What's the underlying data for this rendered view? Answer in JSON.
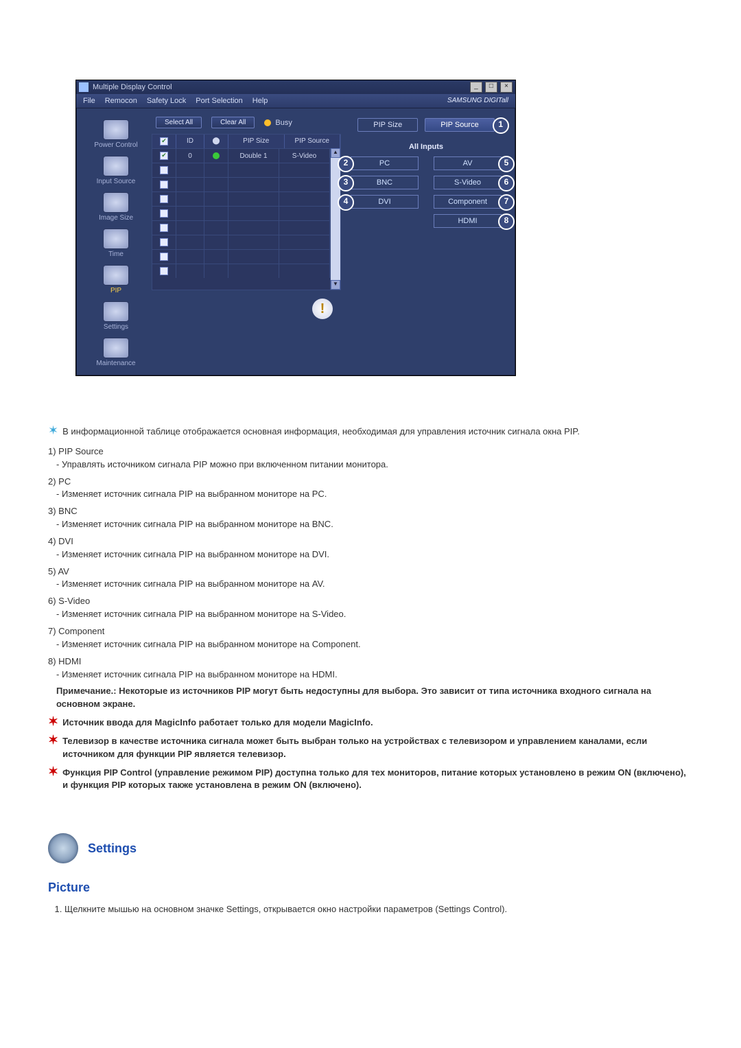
{
  "app": {
    "title": "Multiple Display Control",
    "menu": [
      "File",
      "Remocon",
      "Safety Lock",
      "Port Selection",
      "Help"
    ],
    "brand": "SAMSUNG DIGITall",
    "side": [
      {
        "label": "Power Control"
      },
      {
        "label": "Input Source"
      },
      {
        "label": "Image Size"
      },
      {
        "label": "Time"
      },
      {
        "label": "PIP",
        "active": true
      },
      {
        "label": "Settings"
      },
      {
        "label": "Maintenance"
      }
    ],
    "toolbar": {
      "select_all": "Select All",
      "clear_all": "Clear All",
      "busy": "Busy"
    },
    "grid": {
      "headers": {
        "id": "ID",
        "pip_size": "PIP Size",
        "pip_source": "PIP Source"
      },
      "rows": [
        {
          "checked": true,
          "id": "0",
          "status": "on",
          "pip_size": "Double 1",
          "pip_source": "S-Video"
        },
        {
          "checked": false,
          "id": "",
          "status": "",
          "pip_size": "",
          "pip_source": ""
        },
        {
          "checked": false,
          "id": "",
          "status": "",
          "pip_size": "",
          "pip_source": ""
        },
        {
          "checked": false,
          "id": "",
          "status": "",
          "pip_size": "",
          "pip_source": ""
        },
        {
          "checked": false,
          "id": "",
          "status": "",
          "pip_size": "",
          "pip_source": ""
        },
        {
          "checked": false,
          "id": "",
          "status": "",
          "pip_size": "",
          "pip_source": ""
        },
        {
          "checked": false,
          "id": "",
          "status": "",
          "pip_size": "",
          "pip_source": ""
        },
        {
          "checked": false,
          "id": "",
          "status": "",
          "pip_size": "",
          "pip_source": ""
        },
        {
          "checked": false,
          "id": "",
          "status": "",
          "pip_size": "",
          "pip_source": ""
        }
      ]
    },
    "right": {
      "tab_size": "PIP Size",
      "tab_source": "PIP Source",
      "callout_source": "1",
      "panel_title": "All Inputs",
      "choices": [
        {
          "label": "PC",
          "num": "2",
          "side": "left"
        },
        {
          "label": "AV",
          "num": "5",
          "side": "right"
        },
        {
          "label": "BNC",
          "num": "3",
          "side": "left"
        },
        {
          "label": "S-Video",
          "num": "6",
          "side": "right"
        },
        {
          "label": "DVI",
          "num": "4",
          "side": "left"
        },
        {
          "label": "Component",
          "num": "7",
          "side": "right"
        },
        {
          "label": "",
          "num": "",
          "side": ""
        },
        {
          "label": "HDMI",
          "num": "8",
          "side": "right"
        }
      ]
    }
  },
  "doc": {
    "intro": "В информационной таблице отображается основная информация, необходимая для управления источник сигнала окна PIP.",
    "items": [
      {
        "n": "1)",
        "t": "PIP Source",
        "d": "- Управлять источником сигнала PIP можно при включенном питании монитора."
      },
      {
        "n": "2)",
        "t": "PC",
        "d": "- Изменяет источник сигнала PIP на выбранном мониторе на PC."
      },
      {
        "n": "3)",
        "t": "BNC",
        "d": "- Изменяет источник сигнала PIP на выбранном мониторе на BNC."
      },
      {
        "n": "4)",
        "t": "DVI",
        "d": "- Изменяет источник сигнала PIP на выбранном мониторе на DVI."
      },
      {
        "n": "5)",
        "t": "AV",
        "d": "- Изменяет источник сигнала PIP на выбранном мониторе на AV."
      },
      {
        "n": "6)",
        "t": "S-Video",
        "d": "- Изменяет источник сигнала PIP на выбранном мониторе на S-Video."
      },
      {
        "n": "7)",
        "t": "Component",
        "d": "- Изменяет источник сигнала PIP на выбранном мониторе на Component."
      },
      {
        "n": "8)",
        "t": "HDMI",
        "d": "- Изменяет источник сигнала PIP на выбранном мониторе на HDMI."
      }
    ],
    "note": "Примечание.: Некоторые из источников PIP могут быть недоступны для выбора. Это зависит от типа источника входного сигнала на основном экране.",
    "bullets": [
      "Источник ввода для MagicInfo работает только для модели MagicInfo.",
      "Телевизор в качестве источника сигнала может быть выбран только на устройствах с телевизором и управлением каналами, если источником для функции PIP является телевизор.",
      "Функция PIP Control (управление режимом PIP) доступна только для тех мониторов, питание которых установлено в режим ON (включено), и функция PIP которых также установлена в режим ON (включено)."
    ],
    "settings_head": "Settings",
    "picture_head": "Picture",
    "picture_item": "Щелкните мышью на основном значке Settings, открывается окно настройки параметров (Settings Control)."
  }
}
